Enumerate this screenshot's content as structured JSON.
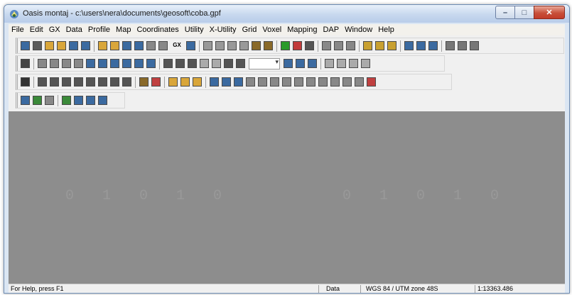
{
  "window": {
    "title": "Oasis montaj - c:\\users\\nera\\documents\\geosoft\\coba.gpf"
  },
  "menu": [
    "File",
    "Edit",
    "GX",
    "Data",
    "Profile",
    "Map",
    "Coordinates",
    "Utility",
    "X-Utility",
    "Grid",
    "Voxel",
    "Mapping",
    "DAP",
    "Window",
    "Help"
  ],
  "toolbar": {
    "gx_label": "GX"
  },
  "background_digits": [
    "0 1 0 1 0",
    "0 1 0 1 0"
  ],
  "status": {
    "help": "For Help, press F1",
    "mode": "Data",
    "projection": "WGS 84 / UTM zone 48S",
    "scale": "1:13363.486"
  },
  "colors": {
    "title_gradient_top": "#e8f0fa",
    "close_button": "#c8503a",
    "workspace": "#8d8d8d"
  }
}
